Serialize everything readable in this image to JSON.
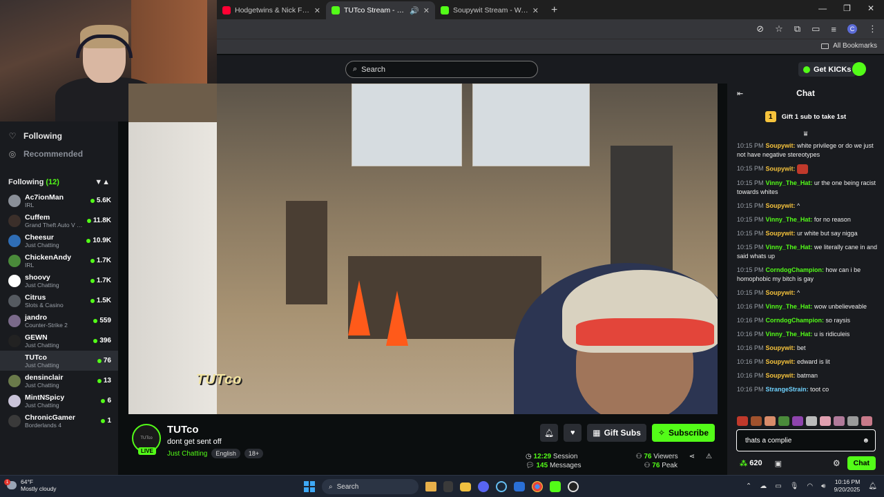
{
  "browser": {
    "tabs": [
      {
        "title": "Hodgetwins & Nick Fuentes GO",
        "favicon": "youtube-icon",
        "active": false
      },
      {
        "title": "TUTco Stream - Watch Live",
        "favicon": "kick-icon",
        "active": true
      },
      {
        "title": "Soupywit Stream - Watch Live o",
        "favicon": "kick-icon",
        "active": false
      }
    ],
    "profile_initial": "C",
    "bookmarks_label": "All Bookmarks"
  },
  "header": {
    "search_placeholder": "Search",
    "get_kicks_label": "Get KICKs"
  },
  "sidebar": {
    "nav": [
      {
        "label": "Following",
        "icon": "heart-icon"
      },
      {
        "label": "Recommended",
        "icon": "compass-icon"
      }
    ],
    "following_label": "Following",
    "following_count": "(12)",
    "channels": [
      {
        "name": "Ac7ionMan",
        "category": "IRL",
        "viewers": "5.6K",
        "avatar_color": "#8a8f98"
      },
      {
        "name": "Cuffem",
        "category": "Grand Theft Auto V (...",
        "viewers": "11.8K",
        "avatar_color": "#3b2f2a"
      },
      {
        "name": "Cheesur",
        "category": "Just Chatting",
        "viewers": "10.9K",
        "avatar_color": "#2f6db5"
      },
      {
        "name": "ChickenAndy",
        "category": "IRL",
        "viewers": "1.7K",
        "avatar_color": "#4a8a3a"
      },
      {
        "name": "shoovy",
        "category": "Just Chatting",
        "viewers": "1.7K",
        "avatar_color": "#ffffff"
      },
      {
        "name": "Citrus",
        "category": "Slots & Casino",
        "viewers": "1.5K",
        "avatar_color": "#555a60"
      },
      {
        "name": "jandro",
        "category": "Counter-Strike 2",
        "viewers": "559",
        "avatar_color": "#7a6a8a"
      },
      {
        "name": "GEWN",
        "category": "Just Chatting",
        "viewers": "396",
        "avatar_color": "#222222"
      },
      {
        "name": "TUTco",
        "category": "Just Chatting",
        "viewers": "76",
        "avatar_color": "#2b2e34"
      },
      {
        "name": "densinclair",
        "category": "Just Chatting",
        "viewers": "13",
        "avatar_color": "#6a7a4a"
      },
      {
        "name": "MintNSpicy",
        "category": "Just Chatting",
        "viewers": "6",
        "avatar_color": "#c9c3d8"
      },
      {
        "name": "ChronicGamer",
        "category": "Borderlands 4",
        "viewers": "1",
        "avatar_color": "#3a3a3a"
      }
    ]
  },
  "video": {
    "overlay_text": "TUTco"
  },
  "stream": {
    "avatar_text": "TUTco",
    "live_label": "LIVE",
    "name": "TUTco",
    "title": "dont get sent off",
    "category": "Just Chatting",
    "language": "English",
    "age": "18+",
    "gift_label": "Gift Subs",
    "subscribe_label": "Subscribe",
    "stats": {
      "session_time": "12:29",
      "session_label": "Session",
      "messages_count": "145",
      "messages_label": "Messages",
      "viewers_count": "76",
      "viewers_label": "Viewers",
      "peak_count": "76",
      "peak_label": "Peak"
    }
  },
  "chat": {
    "title": "Chat",
    "gift_rank": "1",
    "gift_banner": "Gift 1 sub to take 1st",
    "messages": [
      {
        "time": "10:15 PM",
        "user": "Soupywit:",
        "color": "#f6c33c",
        "text": "white privilege or do we just not have negative stereotypes"
      },
      {
        "time": "10:15 PM",
        "user": "Soupywit:",
        "color": "#f6c33c",
        "text": "",
        "emote": true
      },
      {
        "time": "10:15 PM",
        "user": "Vinny_The_Hat:",
        "color": "#53fc18",
        "text": "ur the one being racist towards whites"
      },
      {
        "time": "10:15 PM",
        "user": "Soupywit:",
        "color": "#f6c33c",
        "text": "^"
      },
      {
        "time": "10:15 PM",
        "user": "Vinny_The_Hat:",
        "color": "#53fc18",
        "text": "for no reason"
      },
      {
        "time": "10:15 PM",
        "user": "Soupywit:",
        "color": "#f6c33c",
        "text": "ur white but say nigga"
      },
      {
        "time": "10:15 PM",
        "user": "Vinny_The_Hat:",
        "color": "#53fc18",
        "text": "we literally cane in and said whats up"
      },
      {
        "time": "10:15 PM",
        "user": "CorndogChampion:",
        "color": "#53fc18",
        "text": "how can i be homophobic my bitch is gay"
      },
      {
        "time": "10:15 PM",
        "user": "Soupywit:",
        "color": "#f6c33c",
        "text": "^"
      },
      {
        "time": "10:16 PM",
        "user": "Vinny_The_Hat:",
        "color": "#53fc18",
        "text": "wow unbelieveable"
      },
      {
        "time": "10:16 PM",
        "user": "CorndogChampion:",
        "color": "#53fc18",
        "text": "so raysis"
      },
      {
        "time": "10:16 PM",
        "user": "Vinny_The_Hat:",
        "color": "#53fc18",
        "text": "u is ridiculeis"
      },
      {
        "time": "10:16 PM",
        "user": "Soupywit:",
        "color": "#f6c33c",
        "text": "bet"
      },
      {
        "time": "10:16 PM",
        "user": "Soupywit:",
        "color": "#f6c33c",
        "text": "edward is lit"
      },
      {
        "time": "10:16 PM",
        "user": "Soupywit:",
        "color": "#f6c33c",
        "text": "batman"
      },
      {
        "time": "10:16 PM",
        "user": "StrangeStrain:",
        "color": "#6fd3ff",
        "text": "toot co"
      }
    ],
    "input_value": "thats a complie",
    "points": "620",
    "send_label": "Chat"
  },
  "taskbar": {
    "weather_temp": "64°F",
    "weather_desc": "Mostly cloudy",
    "weather_badge": "1",
    "search_label": "Search",
    "time": "10:16 PM",
    "date": "9/20/2025"
  }
}
